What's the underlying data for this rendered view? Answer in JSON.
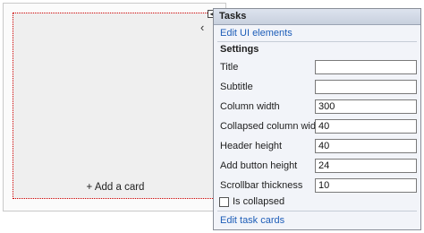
{
  "designer": {
    "add_card": "+ Add a card",
    "chevron": "‹",
    "smart_tag": "◂"
  },
  "tasks": {
    "header": "Tasks",
    "edit_ui": "Edit UI elements",
    "settings_title": "Settings",
    "rows": [
      {
        "label": "Title",
        "value": ""
      },
      {
        "label": "Subtitle",
        "value": ""
      },
      {
        "label": "Column width",
        "value": "300"
      },
      {
        "label": "Collapsed column width",
        "value": "40"
      },
      {
        "label": "Header height",
        "value": "40"
      },
      {
        "label": "Add button height",
        "value": "24"
      },
      {
        "label": "Scrollbar thickness",
        "value": "10"
      }
    ],
    "is_collapsed_label": "Is collapsed",
    "is_collapsed": false,
    "edit_task_cards": "Edit task cards"
  }
}
